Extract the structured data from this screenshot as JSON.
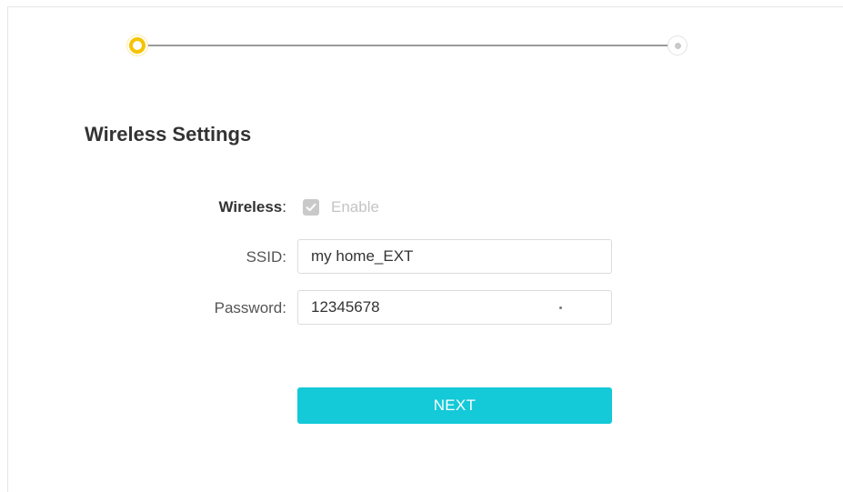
{
  "progress": {
    "current_step": 1,
    "total_steps": 2,
    "colors": {
      "active": "#f5c400",
      "idle": "#c9c9c9",
      "line": "#9a9a9a"
    }
  },
  "section": {
    "title": "Wireless Settings"
  },
  "form": {
    "wireless": {
      "label": "Wireless",
      "colon": ":",
      "checkbox_label": "Enable",
      "checked": true
    },
    "ssid": {
      "label": "SSID:",
      "value": "my home_EXT"
    },
    "password": {
      "label": "Password:",
      "value": "12345678",
      "toggle_icon": "show-password-icon"
    }
  },
  "actions": {
    "next_label": "NEXT",
    "next_color": "#14c9d8"
  }
}
